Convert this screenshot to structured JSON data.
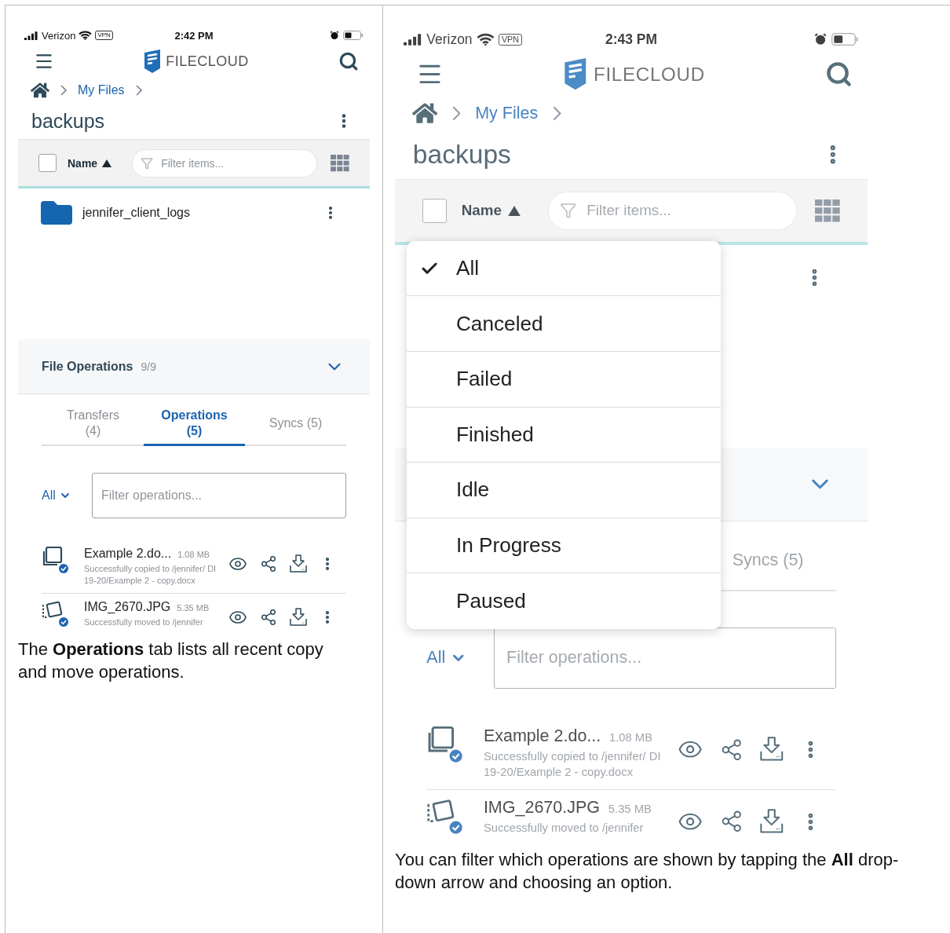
{
  "panels": [
    {
      "phone": {
        "status": {
          "carrier": "Verizon",
          "vpn": "VPN",
          "time": "2:42 PM"
        },
        "logo": "FILECLOUD",
        "breadcrumb": "My Files",
        "title": "backups",
        "toolbar": {
          "select_all_checked": false,
          "sort_label": "Name",
          "placeholder": "Filter items..."
        },
        "files": [
          {
            "name": "jennifer_client_logs"
          }
        ],
        "file_operations": {
          "title": "File Operations",
          "count": "9/9"
        },
        "tabs": [
          {
            "label": "Transfers",
            "count": "(4)",
            "selected": false
          },
          {
            "label": "Operations",
            "count": "(5)",
            "selected": true
          },
          {
            "label": "Syncs (5)",
            "selected": false
          }
        ],
        "filter": {
          "label": "All",
          "placeholder": "Filter operations..."
        },
        "operations": [
          {
            "kind": "copy",
            "name": "Example 2.do...",
            "size": "1.08 MB",
            "status": "Successfully copied to /jennifer/ DI 19-20/Example 2 - copy.docx"
          },
          {
            "kind": "move",
            "name": "IMG_2670.JPG",
            "size": "5.35 MB",
            "status": "Successfully moved to /jennifer"
          }
        ]
      },
      "caption": "The **Operations** tab lists all recent copy and move operations."
    },
    {
      "phone": {
        "status": {
          "carrier": "Verizon",
          "vpn": "VPN",
          "time": "2:43 PM"
        },
        "logo": "FILECLOUD",
        "breadcrumb": "My Files",
        "title": "backups",
        "toolbar": {
          "select_all_checked": false,
          "sort_label": "Name",
          "placeholder": "Filter items..."
        },
        "tabs": [
          {
            "label": "Syncs (5)",
            "selected": false
          }
        ],
        "filter": {
          "label": "All",
          "placeholder": "Filter operations..."
        },
        "operations": [
          {
            "kind": "copy",
            "name": "Example 2.do...",
            "size": "1.08 MB",
            "status": "Successfully copied to /jennifer/ DI 19-20/Example 2 - copy.docx"
          },
          {
            "kind": "move",
            "name": "IMG_2670.JPG",
            "size": "5.35 MB",
            "status": "Successfully moved to /jennifer"
          }
        ],
        "menu": [
          {
            "label": "All",
            "selected": true
          },
          {
            "label": "Canceled",
            "selected": false
          },
          {
            "label": "Failed",
            "selected": false
          },
          {
            "label": "Finished",
            "selected": false
          },
          {
            "label": "Idle",
            "selected": false
          },
          {
            "label": "In Progress",
            "selected": false
          },
          {
            "label": "Paused",
            "selected": false
          }
        ]
      },
      "caption": "You can filter which operations are shown by tapping the **All** drop-down arrow and choosing an option."
    }
  ]
}
